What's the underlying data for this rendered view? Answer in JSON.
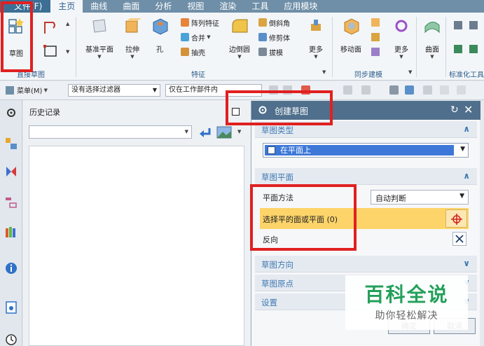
{
  "menu": {
    "items": [
      {
        "label": "文件(F)"
      },
      {
        "label": "主页"
      },
      {
        "label": "曲线"
      },
      {
        "label": "曲面"
      },
      {
        "label": "分析"
      },
      {
        "label": "视图"
      },
      {
        "label": "渲染"
      },
      {
        "label": "工具"
      },
      {
        "label": "应用模块"
      }
    ],
    "active_index": 1
  },
  "ribbon": {
    "sketch_label": "草图",
    "direct_sketch_group": "直接草图",
    "datum_plane": "基准平面",
    "extrude": "拉伸",
    "hole": "孔",
    "pattern_feature": "阵列特征",
    "unite": "合并",
    "shell": "抽壳",
    "edge_blend": "边倒圆",
    "chamfer": "倒斜角",
    "trim_body": "修剪体",
    "draft": "拔模",
    "more1": "更多",
    "feature_group": "特征",
    "move_face": "移动面",
    "more2": "更多",
    "sync_group": "同步建模",
    "surface": "曲面",
    "standard_group": "标准化工具"
  },
  "toolbar": {
    "menu_label": "菜单(M)",
    "filter_value": "没有选择过滤器",
    "scope_value": "仅在工作部件内"
  },
  "history": {
    "title": "历史记录"
  },
  "dialog": {
    "title": "创建草图",
    "sketch_type_label": "草图类型",
    "sketch_type_value": "在平面上",
    "sketch_plane_label": "草图平面",
    "plane_method_label": "平面方法",
    "plane_method_value": "自动判断",
    "select_face_label": "选择平的面或平面 (0)",
    "reverse_label": "反向",
    "sketch_orient_label": "草图方向",
    "sketch_origin_label": "草图原点",
    "settings_label": "设置",
    "ok_label": "确定",
    "cancel_label": "取消"
  },
  "watermark": {
    "main": "百科全说",
    "sub": "助你轻松解决"
  },
  "colors": {
    "accent_blue": "#4f6f8c",
    "highlight_yellow": "#fdd46a",
    "red_annotation": "#e02020",
    "watermark_green": "#23a05a"
  }
}
